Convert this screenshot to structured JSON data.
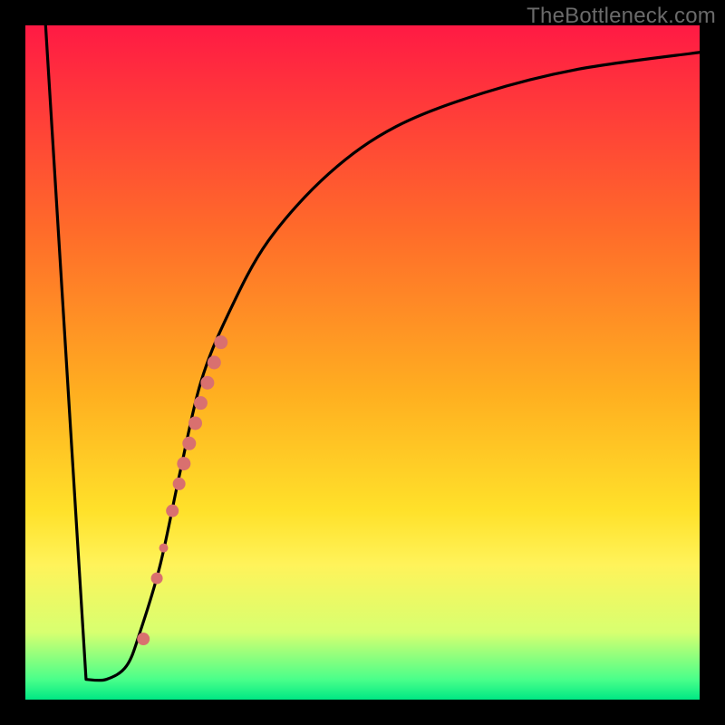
{
  "watermark": "TheBottleneck.com",
  "chart_data": {
    "type": "line",
    "title": "",
    "xlabel": "",
    "ylabel": "",
    "xlim": [
      0,
      100
    ],
    "ylim": [
      0,
      100
    ],
    "grid": false,
    "series": [
      {
        "name": "bottleneck-curve",
        "x": [
          3,
          9,
          12,
          15,
          17,
          20,
          23,
          26,
          30,
          36,
          45,
          55,
          68,
          82,
          100
        ],
        "y": [
          100,
          3,
          3,
          5,
          10,
          20,
          34,
          47,
          57,
          68,
          78,
          85,
          90,
          93.5,
          96
        ]
      }
    ],
    "markers": [
      {
        "name": "highlight-segment",
        "x": 17.5,
        "y": 9,
        "r": 7
      },
      {
        "name": "highlight-point",
        "x": 19.5,
        "y": 18,
        "r": 6.5
      },
      {
        "name": "highlight-point",
        "x": 20.5,
        "y": 22.5,
        "r": 5
      },
      {
        "name": "highlight-point",
        "x": 21.8,
        "y": 28,
        "r": 7
      },
      {
        "name": "highlight-point",
        "x": 22.8,
        "y": 32,
        "r": 7
      },
      {
        "name": "highlight-point",
        "x": 23.5,
        "y": 35,
        "r": 7.5
      },
      {
        "name": "highlight-point",
        "x": 24.3,
        "y": 38,
        "r": 7.5
      },
      {
        "name": "highlight-point",
        "x": 25.2,
        "y": 41,
        "r": 7.5
      },
      {
        "name": "highlight-point",
        "x": 26.0,
        "y": 44,
        "r": 7.5
      },
      {
        "name": "highlight-point",
        "x": 27.0,
        "y": 47,
        "r": 7.5
      },
      {
        "name": "highlight-point",
        "x": 28.0,
        "y": 50,
        "r": 7.5
      },
      {
        "name": "highlight-point",
        "x": 29.0,
        "y": 53,
        "r": 7.5
      }
    ],
    "background_gradient": {
      "top": "#ff1a44",
      "bottom": "#00e884"
    }
  }
}
